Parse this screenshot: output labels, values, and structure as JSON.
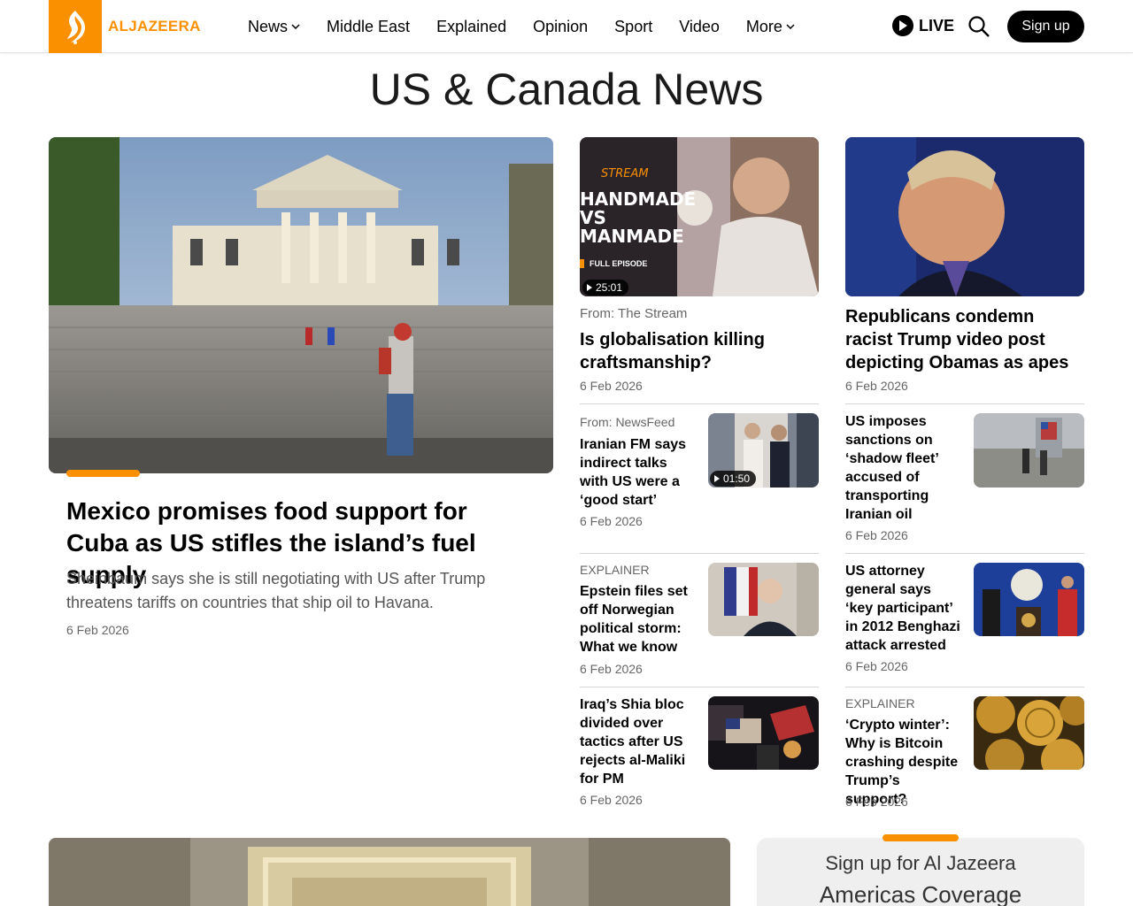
{
  "header": {
    "logo_text": "ALJAZEERA",
    "nav": [
      {
        "label": "News",
        "has_dropdown": true
      },
      {
        "label": "Middle East",
        "has_dropdown": false
      },
      {
        "label": "Explained",
        "has_dropdown": false
      },
      {
        "label": "Opinion",
        "has_dropdown": false
      },
      {
        "label": "Sport",
        "has_dropdown": false
      },
      {
        "label": "Video",
        "has_dropdown": false
      },
      {
        "label": "More",
        "has_dropdown": true
      }
    ],
    "live_label": "LIVE",
    "signup_label": "Sign up",
    "brand_color": "#fa9000"
  },
  "page_title": "US & Canada News",
  "hero": {
    "title": "Mexico promises food support for Cuba as US stifles the island’s fuel supply",
    "summary": "Sheinbaum says she is still negotiating with US after Trump threatens tariffs on countries that ship oil to Havana.",
    "date": "6 Feb 2026"
  },
  "col2": {
    "top": {
      "video_duration": "25:01",
      "thumb_lines": [
        "HANDMADE",
        "VS",
        "MANMADE"
      ],
      "thumb_badge": "FULL EPISODE",
      "kicker": "From: The Stream",
      "title": "Is globalisation killing craftsmanship?",
      "date": "6 Feb 2026"
    },
    "items": [
      {
        "kicker": "From: NewsFeed",
        "title": "Iranian FM says indirect talks with US were a ‘good start’",
        "date": "6 Feb 2026",
        "video_duration": "01:50"
      },
      {
        "kicker": "EXPLAINER",
        "title": "Epstein files set off Norwegian political storm: What we know",
        "date": "6 Feb 2026"
      },
      {
        "kicker": "",
        "title": "Iraq’s Shia bloc divided over tactics after US rejects al-Maliki for PM",
        "date": "6 Feb 2026"
      }
    ]
  },
  "col3": {
    "top": {
      "title": "Republicans condemn racist Trump video post depicting Obamas as apes",
      "date": "6 Feb 2026"
    },
    "items": [
      {
        "kicker": "",
        "title": "US imposes sanctions on ‘shadow fleet’ accused of transporting Iranian oil",
        "date": "6 Feb 2026"
      },
      {
        "kicker": "",
        "title": "US attorney general says ‘key participant’ in 2012 Benghazi attack arrested",
        "date": "6 Feb 2026"
      },
      {
        "kicker": "EXPLAINER",
        "title": "‘Crypto winter’: Why is Bitcoin crashing despite Trump’s support?",
        "date": "6 Feb 2026"
      }
    ]
  },
  "newsletter": {
    "line1": "Sign up for Al Jazeera",
    "line2": "Americas Coverage"
  }
}
